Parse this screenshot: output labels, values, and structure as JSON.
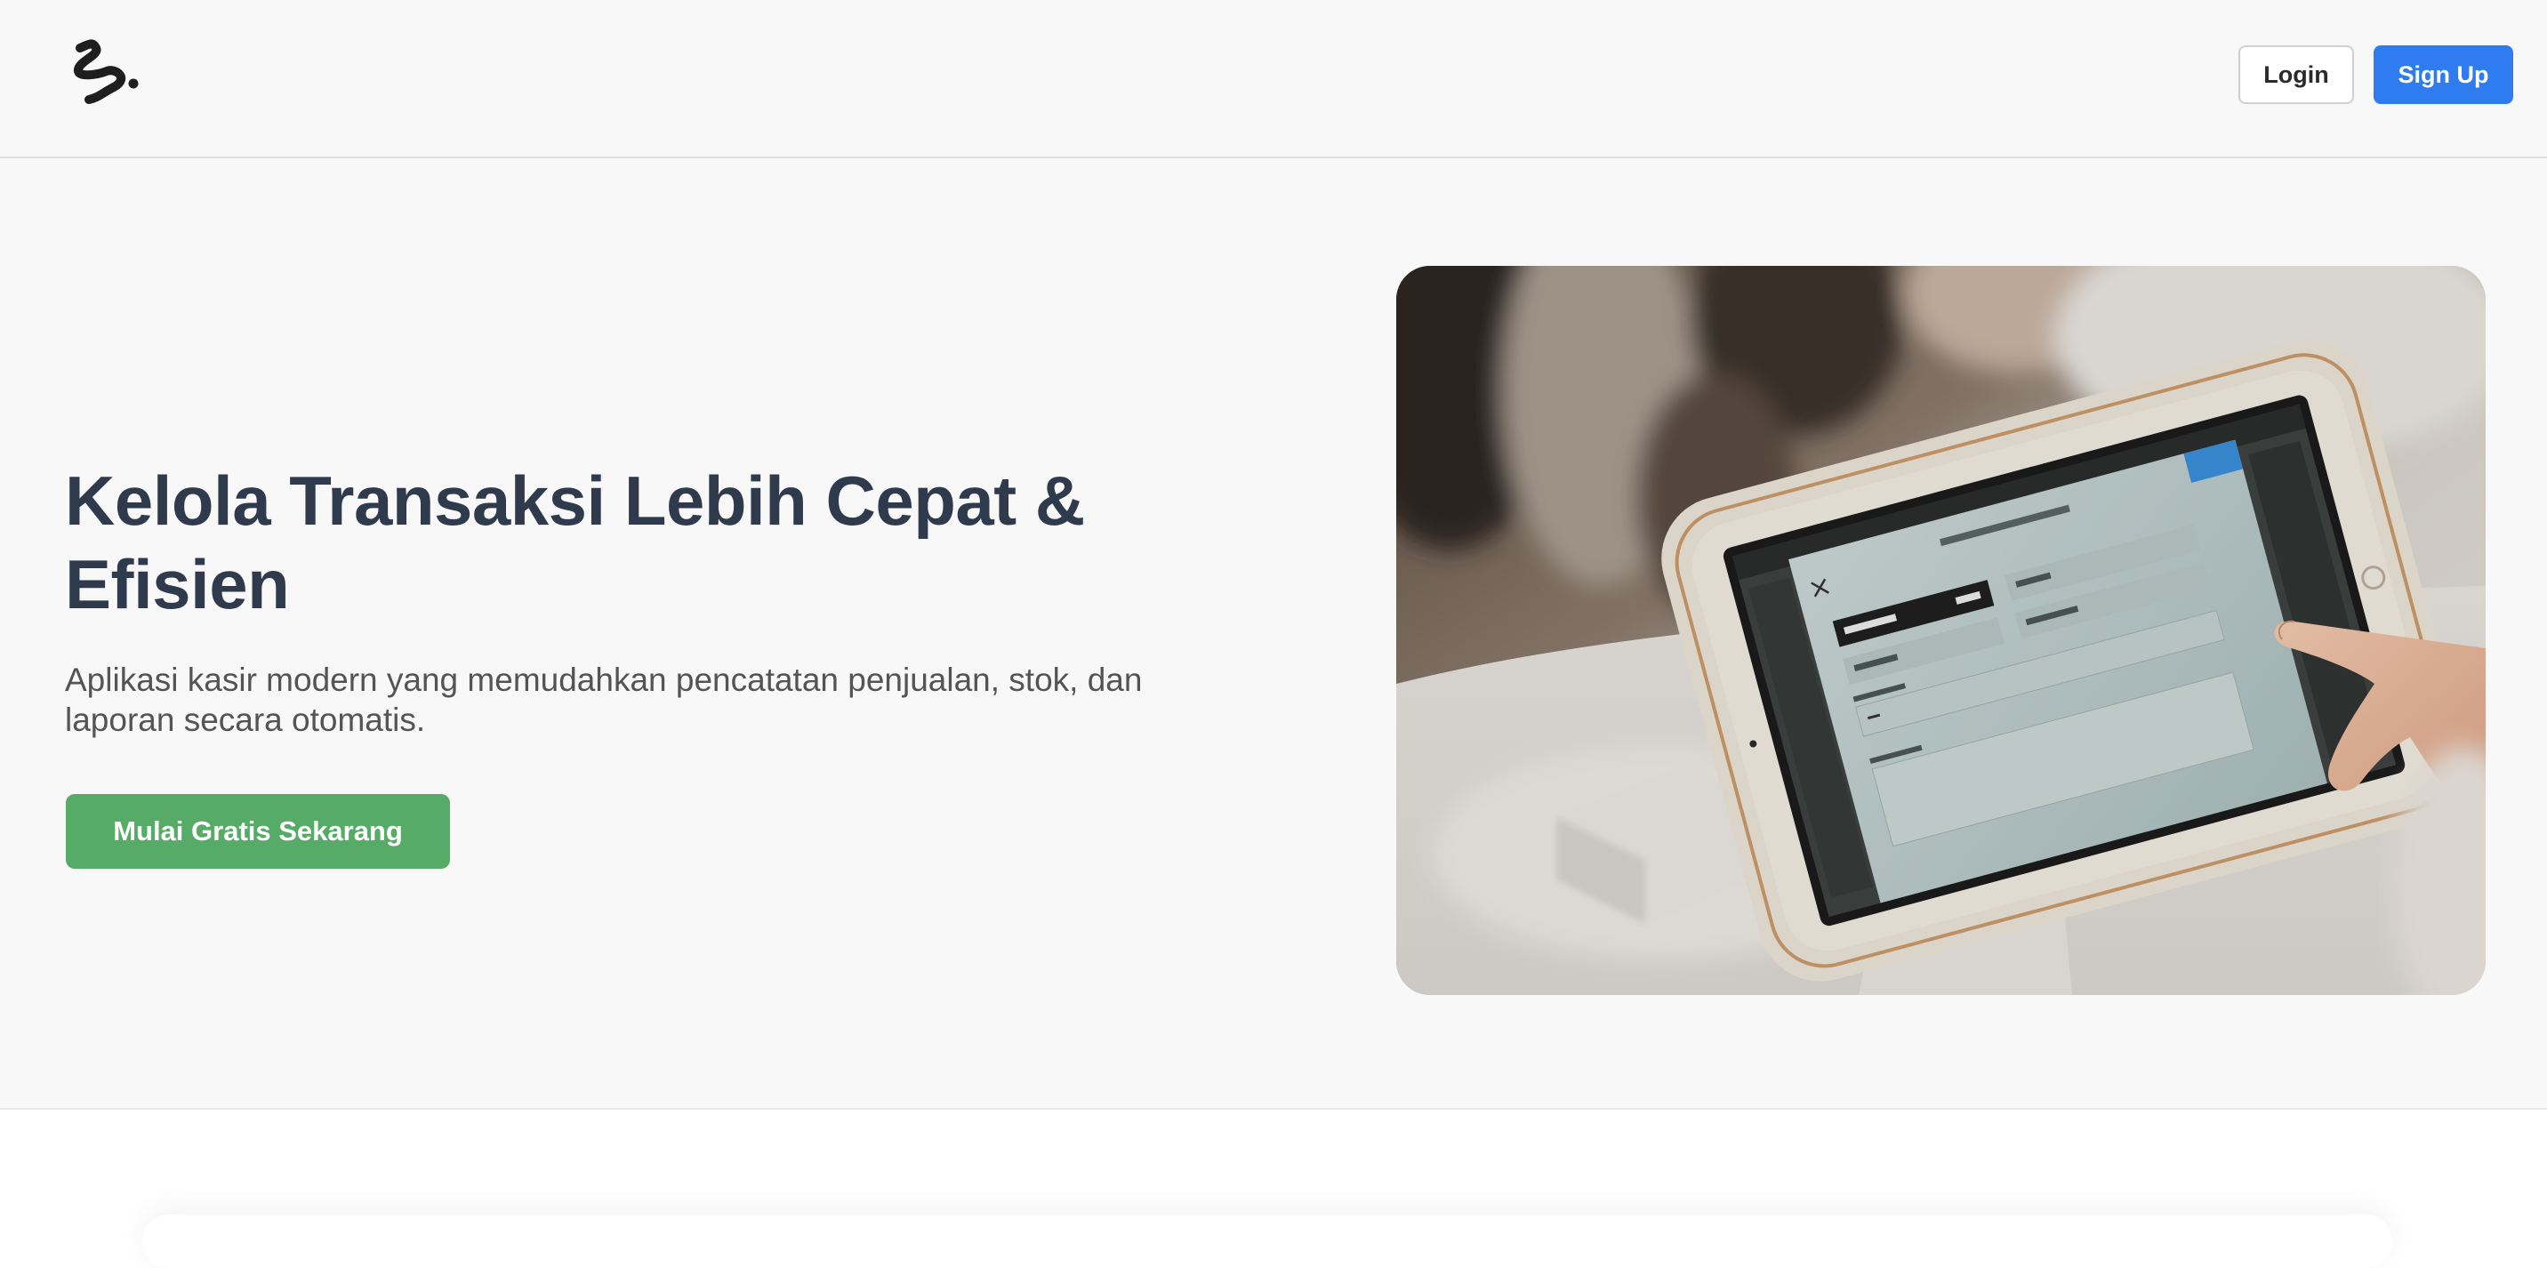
{
  "header": {
    "login_label": "Login",
    "signup_label": "Sign Up",
    "logo_icon": "brand-squiggle-logo"
  },
  "hero": {
    "title": "Kelola Transaksi Lebih Cepat & Efisien",
    "subtitle": "Aplikasi kasir modern yang memudahkan pencatatan penjualan, stok, dan laporan secara otomatis.",
    "cta_label": "Mulai Gratis Sekarang"
  },
  "colors": {
    "primary_blue": "#2e7cf0",
    "cta_green": "#56ab66",
    "heading": "#2f3b4d",
    "background": "#f8f8f8"
  }
}
